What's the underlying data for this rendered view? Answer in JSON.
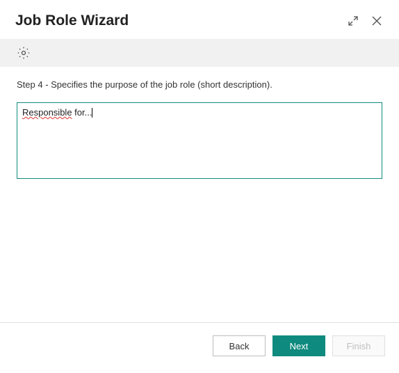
{
  "header": {
    "title": "Job Role Wizard"
  },
  "step": {
    "label": "Step 4 - Specifies the purpose of the job role (short description)."
  },
  "input": {
    "value_word1": "Responsible",
    "value_rest": " for..."
  },
  "footer": {
    "back": "Back",
    "next": "Next",
    "finish": "Finish"
  }
}
